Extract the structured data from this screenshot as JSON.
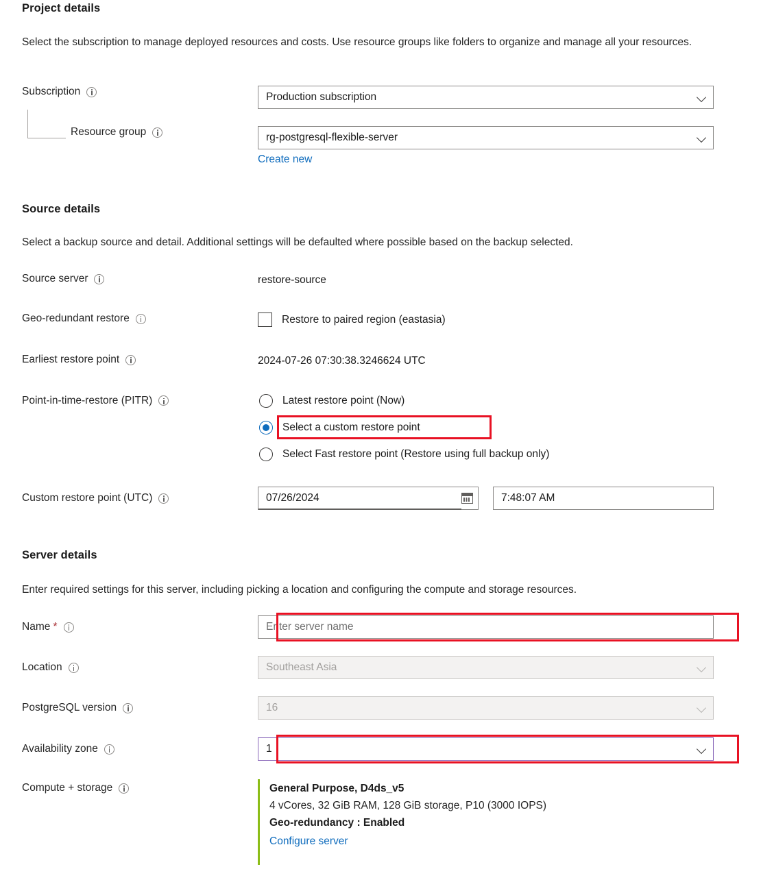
{
  "project_details": {
    "heading": "Project details",
    "description": "Select the subscription to manage deployed resources and costs. Use resource groups like folders to organize and manage all your resources.",
    "subscription": {
      "label": "Subscription",
      "value": "Production subscription"
    },
    "resource_group": {
      "label": "Resource group",
      "value": "rg-postgresql-flexible-server",
      "create_new_link": "Create new"
    }
  },
  "source_details": {
    "heading": "Source details",
    "description": "Select a backup source and detail. Additional settings will be defaulted where possible based on the backup selected.",
    "source_server": {
      "label": "Source server",
      "value": "restore-source"
    },
    "geo_redundant_restore": {
      "label": "Geo-redundant restore",
      "checkbox_label": "Restore to paired region (eastasia)",
      "checked": false
    },
    "earliest_restore_point": {
      "label": "Earliest restore point",
      "value": "2024-07-26 07:30:38.3246624 UTC"
    },
    "pitr": {
      "label": "Point-in-time-restore (PITR)",
      "options": [
        {
          "label": "Latest restore point (Now)",
          "selected": false
        },
        {
          "label": "Select a custom restore point",
          "selected": true
        },
        {
          "label": "Select Fast restore point (Restore using full backup only)",
          "selected": false
        }
      ]
    },
    "custom_restore_point": {
      "label": "Custom restore point (UTC)",
      "date_value": "07/26/2024",
      "time_value": "7:48:07 AM"
    }
  },
  "server_details": {
    "heading": "Server details",
    "description": "Enter required settings for this server, including picking a location and configuring the compute and storage resources.",
    "name": {
      "label": "Name",
      "required_marker": "*",
      "placeholder": "Enter server name",
      "value": ""
    },
    "location": {
      "label": "Location",
      "value": "Southeast Asia",
      "disabled": true
    },
    "postgresql_version": {
      "label": "PostgreSQL version",
      "value": "16",
      "disabled": true
    },
    "availability_zone": {
      "label": "Availability zone",
      "value": "1"
    },
    "compute_storage": {
      "label": "Compute + storage",
      "tier": "General Purpose, D4ds_v5",
      "specs": "4 vCores, 32 GiB RAM, 128 GiB storage, P10 (3000 IOPS)",
      "geo_redundancy": "Geo-redundancy : Enabled",
      "configure_link": "Configure server"
    }
  },
  "colors": {
    "highlight": "#e81123",
    "link": "#0f6cbd",
    "accent_green": "#8cbd18",
    "focus_purple": "#8764b8",
    "required_red": "#a4262c"
  }
}
